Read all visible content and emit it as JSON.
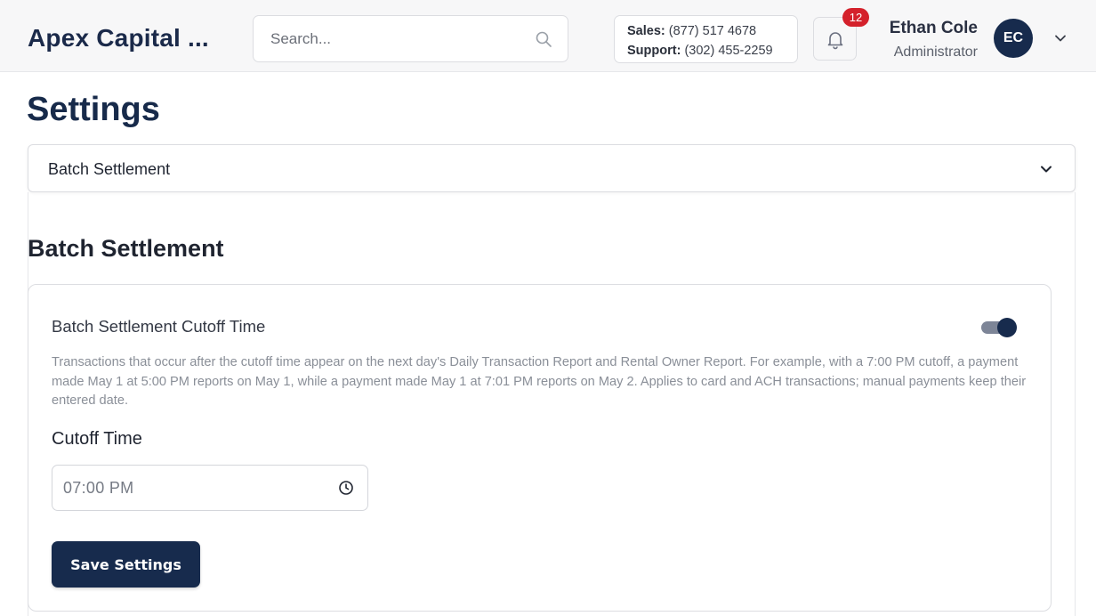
{
  "header": {
    "brand": "Apex Capital ...",
    "search": {
      "placeholder": "Search..."
    },
    "contact": {
      "sales_label": "Sales:",
      "sales_phone": "(877) 517 4678",
      "support_label": "Support:",
      "support_phone": "(302) 455-2259"
    },
    "notifications": {
      "count": "12",
      "icon": "bell-icon"
    },
    "user": {
      "name": "Ethan Cole",
      "role": "Administrator",
      "initials": "EC"
    }
  },
  "page": {
    "title": "Settings"
  },
  "accordion": {
    "selected": "Batch Settlement"
  },
  "section": {
    "title": "Batch Settlement",
    "card": {
      "title": "Batch Settlement Cutoff Time",
      "toggle_on": true,
      "description": "Transactions that occur after the cutoff time appear on the next day's Daily Transaction Report and Rental Owner Report. For example, with a 7:00 PM cutoff, a payment made May 1 at 5:00 PM reports on May 1, while a payment made May 1 at 7:01 PM reports on May 2. Applies to card and ACH transactions; manual payments keep their entered date.",
      "field_label": "Cutoff Time",
      "time_value": "07:00  PM",
      "save_label": "Save Settings"
    }
  },
  "colors": {
    "primary": "#172b4d",
    "badge": "#d4212b",
    "topbar_bg": "#f7f7f8"
  }
}
